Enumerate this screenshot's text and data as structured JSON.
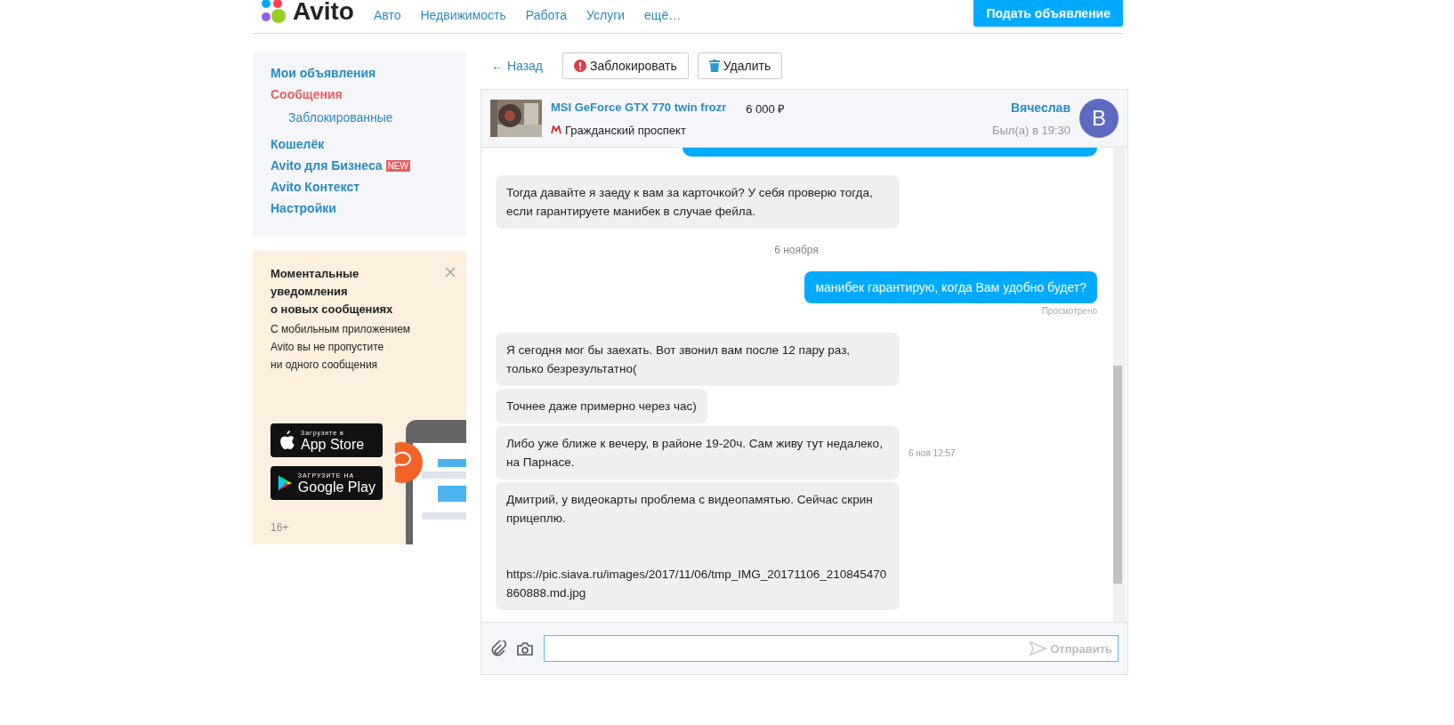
{
  "header": {
    "logo": "Avito",
    "nav": [
      "Авто",
      "Недвижимость",
      "Работа",
      "Услуги",
      "ещё…"
    ],
    "post_button": "Подать объявление"
  },
  "sidebar": {
    "items": [
      {
        "label": "Мои объявления",
        "selected": false
      },
      {
        "label": "Сообщения",
        "selected": true,
        "children": [
          {
            "label": "Заблокированные",
            "selected": false
          }
        ]
      },
      {
        "label": "Кошелёк",
        "selected": false
      },
      {
        "label": "Avito для Бизнеса",
        "selected": false,
        "badge": "NEW"
      },
      {
        "label": "Avito Контекст",
        "selected": false
      },
      {
        "label": "Настройки",
        "selected": false
      }
    ]
  },
  "promo": {
    "title": "Моментальные\nуведомления\nо новых сообщениях",
    "text": "С мобильным приложением\nAvito вы не пропустите\nни одного сообщения",
    "stores": [
      {
        "kind": "apple",
        "small": "Загрузите в",
        "big": "App Store"
      },
      {
        "kind": "google",
        "small": "ЗАГРУЗИТЕ НА",
        "big": "Google Play"
      }
    ],
    "age": "16+"
  },
  "toolbar": {
    "back": "← Назад",
    "block": "Заблокировать",
    "delete": "Удалить"
  },
  "chat": {
    "item": {
      "title": "MSI GeForce GTX 770 twin frozr",
      "price": "6 000 ₽",
      "metro": "Гражданский проспект"
    },
    "user": {
      "name": "Вячеслав",
      "seen": "Был(а) в 19:30",
      "initial": "В"
    },
    "messages": [
      {
        "kind": "stub"
      },
      {
        "kind": "in",
        "text": "Тогда давайте я заеду к вам за карточкой? У себя проверю тогда, если гарантируете манибек в случае фейла."
      },
      {
        "kind": "date",
        "text": "6 ноября"
      },
      {
        "kind": "out",
        "text": "манибек гарантирую, когда Вам удобно будет?",
        "status": "Просмотрено"
      },
      {
        "kind": "in",
        "text": "Я сегодня мог бы заехать. Вот звонил вам после 12 пару раз, только безрезультатно("
      },
      {
        "kind": "in",
        "text": "Точнее даже примерно через час)"
      },
      {
        "kind": "in",
        "text": "Либо уже ближе к вечеру, в районе 19-20ч. Сам живу тут недалеко, на Парнасе.",
        "time": "6 ноя 12:57"
      },
      {
        "kind": "in",
        "text": "Дмитрий, у видеокарты проблема с видеопамятью. Сейчас скрин прицеплю.\n\n\nhttps://pic.siava.ru/images/2017/11/06/tmp_IMG_20171106_210845470860888.md.jpg"
      }
    ],
    "input": {
      "send": "Отправить"
    }
  }
}
